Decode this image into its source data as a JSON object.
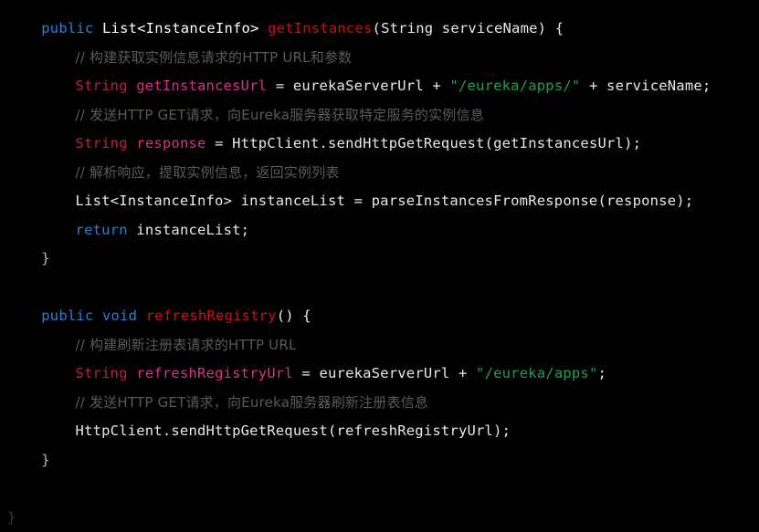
{
  "editor": {
    "language": "java",
    "background_color": "#000000",
    "theme": "dark",
    "colors": {
      "keyword": "#2b7fd4",
      "method_name": "#cc1111",
      "declaration_type": "#c2185b",
      "variable": "#d63384",
      "string_literal": "#1f9e55",
      "comment": "#5a5a5a",
      "plain_text": "#e8e8e8",
      "dim_brace": "#3a3a3a"
    }
  },
  "code": {
    "lines": [
      {
        "id": "line-1",
        "indent": 4,
        "tokens": [
          {
            "t": "public",
            "c": "tok-kw"
          },
          {
            "t": " ",
            "c": "tok-plain"
          },
          {
            "t": "List<InstanceInfo>",
            "c": "tok-type"
          },
          {
            "t": " ",
            "c": "tok-plain"
          },
          {
            "t": "getInstances",
            "c": "tok-method"
          },
          {
            "t": "(String serviceName) {",
            "c": "tok-plain"
          }
        ]
      },
      {
        "id": "line-2",
        "indent": 8,
        "tokens": [
          {
            "t": "// 构建获取实例信息请求的HTTP URL和参数",
            "c": "tok-comment"
          }
        ]
      },
      {
        "id": "line-3",
        "indent": 8,
        "tokens": [
          {
            "t": "String",
            "c": "tok-decl"
          },
          {
            "t": " ",
            "c": "tok-plain"
          },
          {
            "t": "getInstancesUrl",
            "c": "tok-var"
          },
          {
            "t": " = eurekaServerUrl + ",
            "c": "tok-plain"
          },
          {
            "t": "\"/eureka/apps/\"",
            "c": "tok-str"
          },
          {
            "t": " + serviceName;",
            "c": "tok-plain"
          }
        ]
      },
      {
        "id": "line-4",
        "indent": 8,
        "tokens": [
          {
            "t": "// 发送HTTP GET请求，向Eureka服务器获取特定服务的实例信息",
            "c": "tok-comment"
          }
        ]
      },
      {
        "id": "line-5",
        "indent": 8,
        "tokens": [
          {
            "t": "String",
            "c": "tok-decl"
          },
          {
            "t": " ",
            "c": "tok-plain"
          },
          {
            "t": "response",
            "c": "tok-var"
          },
          {
            "t": " = HttpClient.sendHttpGetRequest(getInstancesUrl);",
            "c": "tok-plain"
          }
        ]
      },
      {
        "id": "line-6",
        "indent": 8,
        "tokens": [
          {
            "t": "// 解析响应，提取实例信息，返回实例列表",
            "c": "tok-comment"
          }
        ]
      },
      {
        "id": "line-7",
        "indent": 8,
        "tokens": [
          {
            "t": "List<InstanceInfo> instanceList = parseInstancesFromResponse(response);",
            "c": "tok-plain"
          }
        ]
      },
      {
        "id": "line-8",
        "indent": 8,
        "tokens": [
          {
            "t": "return",
            "c": "tok-kw"
          },
          {
            "t": " instanceList;",
            "c": "tok-plain"
          }
        ]
      },
      {
        "id": "line-9",
        "indent": 4,
        "tokens": [
          {
            "t": "}",
            "c": "tok-brace"
          }
        ]
      },
      {
        "id": "line-10",
        "indent": 0,
        "tokens": []
      },
      {
        "id": "line-11",
        "indent": 4,
        "tokens": [
          {
            "t": "public",
            "c": "tok-kw"
          },
          {
            "t": " ",
            "c": "tok-plain"
          },
          {
            "t": "void",
            "c": "tok-kw"
          },
          {
            "t": " ",
            "c": "tok-plain"
          },
          {
            "t": "refreshRegistry",
            "c": "tok-method"
          },
          {
            "t": "() {",
            "c": "tok-plain"
          }
        ]
      },
      {
        "id": "line-12",
        "indent": 8,
        "tokens": [
          {
            "t": "// 构建刷新注册表请求的HTTP URL",
            "c": "tok-comment"
          }
        ]
      },
      {
        "id": "line-13",
        "indent": 8,
        "tokens": [
          {
            "t": "String",
            "c": "tok-decl"
          },
          {
            "t": " ",
            "c": "tok-plain"
          },
          {
            "t": "refreshRegistryUrl",
            "c": "tok-var"
          },
          {
            "t": " = eurekaServerUrl + ",
            "c": "tok-plain"
          },
          {
            "t": "\"/eureka/apps\"",
            "c": "tok-str"
          },
          {
            "t": ";",
            "c": "tok-plain"
          }
        ]
      },
      {
        "id": "line-14",
        "indent": 8,
        "tokens": [
          {
            "t": "// 发送HTTP GET请求，向Eureka服务器刷新注册表信息",
            "c": "tok-comment"
          }
        ]
      },
      {
        "id": "line-15",
        "indent": 8,
        "tokens": [
          {
            "t": "HttpClient.sendHttpGetRequest(refreshRegistryUrl);",
            "c": "tok-plain"
          }
        ]
      },
      {
        "id": "line-16",
        "indent": 4,
        "tokens": [
          {
            "t": "}",
            "c": "tok-brace"
          }
        ]
      },
      {
        "id": "line-17",
        "indent": 0,
        "tokens": []
      },
      {
        "id": "line-18",
        "indent": 0,
        "tokens": [
          {
            "t": "}",
            "c": "tok-brace-dim"
          }
        ]
      }
    ]
  }
}
